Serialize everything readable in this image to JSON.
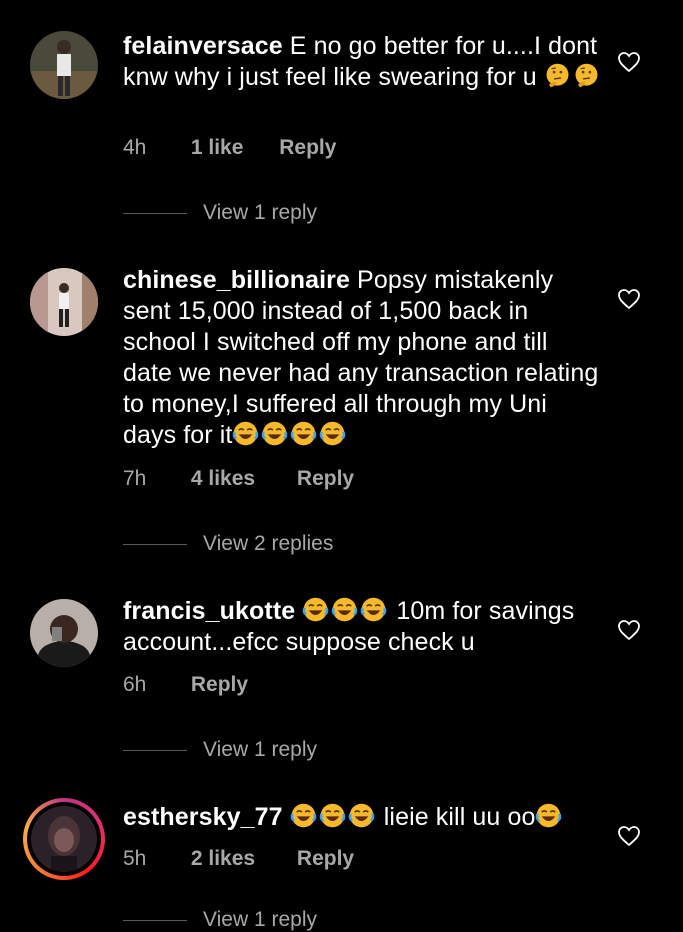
{
  "comments": [
    {
      "username": "felainversace",
      "text": "E no go better for u....I dont knw why i just feel like swearing for u",
      "emojis": [
        "thinking-face-icon",
        "thinking-face-icon"
      ],
      "time": "4h",
      "likes": "1 like",
      "reply": "Reply",
      "view_replies": "View 1 reply"
    },
    {
      "username": "chinese_billionaire",
      "text": "Popsy mistakenly sent 15,000 instead of 1,500 back in school I switched off my phone and till date we never had any transaction relating to money,I suffered all through my Uni days for it",
      "emojis": [
        "laughing-face-icon",
        "laughing-face-icon",
        "laughing-face-icon",
        "laughing-face-icon"
      ],
      "time": "7h",
      "likes": "4 likes",
      "reply": "Reply",
      "view_replies": "View 2 replies"
    },
    {
      "username": "francis_ukotte",
      "text_after_emojis": "10m for savings account...efcc suppose check u",
      "emojis": [
        "laughing-face-icon",
        "laughing-face-icon",
        "laughing-face-icon"
      ],
      "time": "6h",
      "reply": "Reply",
      "view_replies": "View 1 reply"
    },
    {
      "username": "esthersky_77",
      "text_between": "lieie kill uu oo",
      "emojis": [
        "laughing-face-icon",
        "laughing-face-icon",
        "laughing-face-icon",
        "laughing-face-icon"
      ],
      "time": "5h",
      "likes": "2 likes",
      "reply": "Reply",
      "view_replies": "View 1 reply"
    }
  ],
  "colors": {
    "background": "#000000",
    "text": "#ffffff",
    "meta": "#a8a8a8",
    "story_ring": "#e1306c"
  }
}
